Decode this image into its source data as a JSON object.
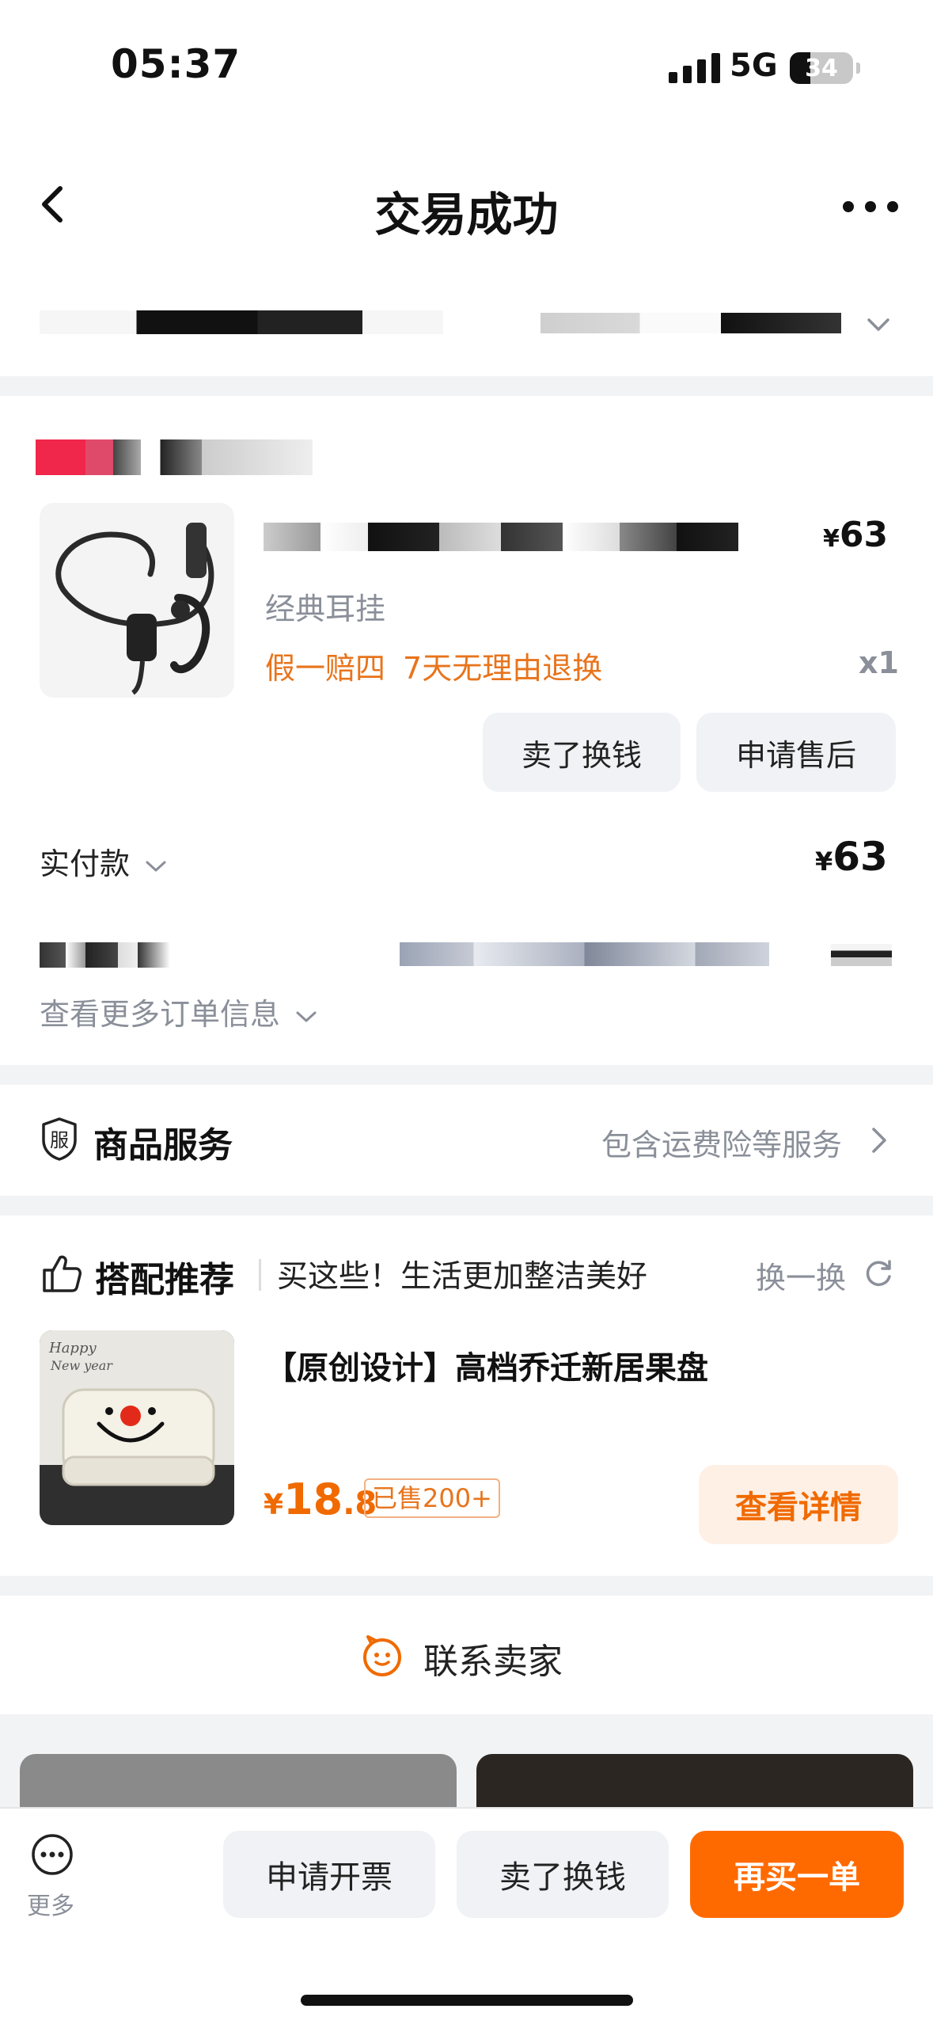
{
  "status_bar": {
    "time": "05:37",
    "network": "5G",
    "battery": "34"
  },
  "nav": {
    "title": "交易成功"
  },
  "product": {
    "price_symbol": "¥",
    "price": "63",
    "spec": "经典耳挂",
    "tags": [
      "假一赔四",
      "7天无理由退换"
    ],
    "quantity": "x1"
  },
  "order_actions": {
    "sell_label": "卖了换钱",
    "after_sale_label": "申请售后"
  },
  "payment": {
    "label": "实付款",
    "symbol": "¥",
    "amount": "63"
  },
  "order_info": {
    "more_label": "查看更多订单信息"
  },
  "service": {
    "badge_char": "服",
    "title": "商品服务",
    "link": "包含运费险等服务"
  },
  "recommend": {
    "title": "搭配推荐",
    "subtitle": "买这些！生活更加整洁美好",
    "refresh_label": "换一换",
    "item": {
      "name": "【原创设计】高档乔迁新居果盘",
      "price_symbol": "¥",
      "price_int": "18",
      "price_dec": ".8",
      "sold": "已售200+",
      "detail_label": "查看详情",
      "image_text_1": "Happy",
      "image_text_2": "New year"
    }
  },
  "contact": {
    "label": "联系卖家"
  },
  "bottom_bar": {
    "more_label": "更多",
    "invoice_label": "申请开票",
    "sell_label": "卖了换钱",
    "rebuy_label": "再买一单"
  },
  "colors": {
    "accent": "#ff6a00",
    "tag_orange": "#e8741c",
    "muted": "#8a8f99",
    "button_gray": "#f0f2f5"
  }
}
